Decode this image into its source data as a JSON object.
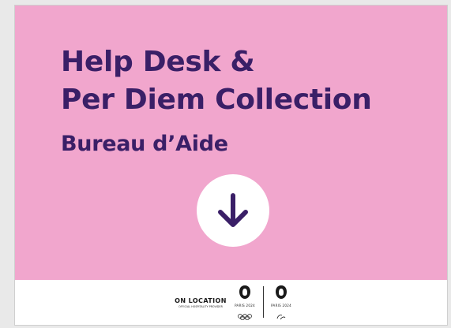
{
  "sign": {
    "title_line1": "Help Desk &",
    "title_line2": "Per Diem Collection",
    "subtitle": "Bureau d’Aide",
    "arrow_icon": "arrow-down-icon"
  },
  "footer": {
    "brand_name": "ON LOCATION",
    "brand_tagline": "OFFICIAL HOSPITALITY PROVIDER",
    "logo1_text": "PARIS 2024",
    "logo2_text": "PARIS 2024"
  },
  "colors": {
    "panel": "#f1a6cd",
    "text": "#3a1f67",
    "footer": "#ffffff"
  }
}
